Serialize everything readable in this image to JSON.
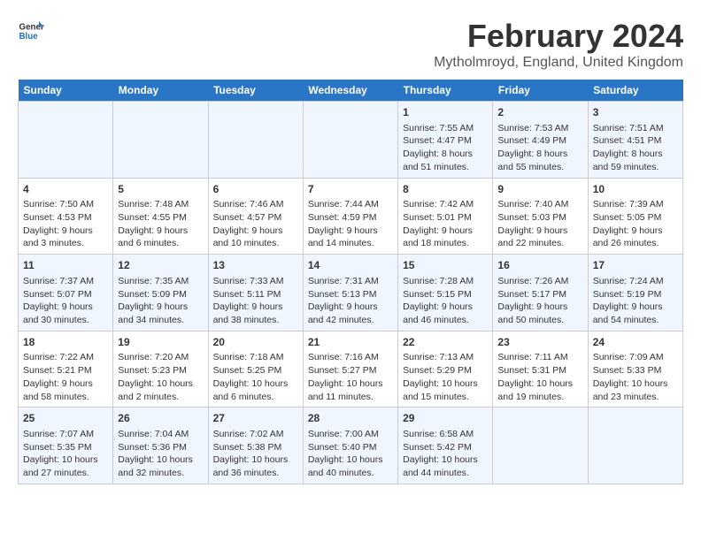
{
  "logo": {
    "line1": "General",
    "line2": "Blue"
  },
  "title": "February 2024",
  "subtitle": "Mytholmroyd, England, United Kingdom",
  "weekdays": [
    "Sunday",
    "Monday",
    "Tuesday",
    "Wednesday",
    "Thursday",
    "Friday",
    "Saturday"
  ],
  "weeks": [
    [
      {
        "day": "",
        "info": ""
      },
      {
        "day": "",
        "info": ""
      },
      {
        "day": "",
        "info": ""
      },
      {
        "day": "",
        "info": ""
      },
      {
        "day": "1",
        "info": "Sunrise: 7:55 AM\nSunset: 4:47 PM\nDaylight: 8 hours\nand 51 minutes."
      },
      {
        "day": "2",
        "info": "Sunrise: 7:53 AM\nSunset: 4:49 PM\nDaylight: 8 hours\nand 55 minutes."
      },
      {
        "day": "3",
        "info": "Sunrise: 7:51 AM\nSunset: 4:51 PM\nDaylight: 8 hours\nand 59 minutes."
      }
    ],
    [
      {
        "day": "4",
        "info": "Sunrise: 7:50 AM\nSunset: 4:53 PM\nDaylight: 9 hours\nand 3 minutes."
      },
      {
        "day": "5",
        "info": "Sunrise: 7:48 AM\nSunset: 4:55 PM\nDaylight: 9 hours\nand 6 minutes."
      },
      {
        "day": "6",
        "info": "Sunrise: 7:46 AM\nSunset: 4:57 PM\nDaylight: 9 hours\nand 10 minutes."
      },
      {
        "day": "7",
        "info": "Sunrise: 7:44 AM\nSunset: 4:59 PM\nDaylight: 9 hours\nand 14 minutes."
      },
      {
        "day": "8",
        "info": "Sunrise: 7:42 AM\nSunset: 5:01 PM\nDaylight: 9 hours\nand 18 minutes."
      },
      {
        "day": "9",
        "info": "Sunrise: 7:40 AM\nSunset: 5:03 PM\nDaylight: 9 hours\nand 22 minutes."
      },
      {
        "day": "10",
        "info": "Sunrise: 7:39 AM\nSunset: 5:05 PM\nDaylight: 9 hours\nand 26 minutes."
      }
    ],
    [
      {
        "day": "11",
        "info": "Sunrise: 7:37 AM\nSunset: 5:07 PM\nDaylight: 9 hours\nand 30 minutes."
      },
      {
        "day": "12",
        "info": "Sunrise: 7:35 AM\nSunset: 5:09 PM\nDaylight: 9 hours\nand 34 minutes."
      },
      {
        "day": "13",
        "info": "Sunrise: 7:33 AM\nSunset: 5:11 PM\nDaylight: 9 hours\nand 38 minutes."
      },
      {
        "day": "14",
        "info": "Sunrise: 7:31 AM\nSunset: 5:13 PM\nDaylight: 9 hours\nand 42 minutes."
      },
      {
        "day": "15",
        "info": "Sunrise: 7:28 AM\nSunset: 5:15 PM\nDaylight: 9 hours\nand 46 minutes."
      },
      {
        "day": "16",
        "info": "Sunrise: 7:26 AM\nSunset: 5:17 PM\nDaylight: 9 hours\nand 50 minutes."
      },
      {
        "day": "17",
        "info": "Sunrise: 7:24 AM\nSunset: 5:19 PM\nDaylight: 9 hours\nand 54 minutes."
      }
    ],
    [
      {
        "day": "18",
        "info": "Sunrise: 7:22 AM\nSunset: 5:21 PM\nDaylight: 9 hours\nand 58 minutes."
      },
      {
        "day": "19",
        "info": "Sunrise: 7:20 AM\nSunset: 5:23 PM\nDaylight: 10 hours\nand 2 minutes."
      },
      {
        "day": "20",
        "info": "Sunrise: 7:18 AM\nSunset: 5:25 PM\nDaylight: 10 hours\nand 6 minutes."
      },
      {
        "day": "21",
        "info": "Sunrise: 7:16 AM\nSunset: 5:27 PM\nDaylight: 10 hours\nand 11 minutes."
      },
      {
        "day": "22",
        "info": "Sunrise: 7:13 AM\nSunset: 5:29 PM\nDaylight: 10 hours\nand 15 minutes."
      },
      {
        "day": "23",
        "info": "Sunrise: 7:11 AM\nSunset: 5:31 PM\nDaylight: 10 hours\nand 19 minutes."
      },
      {
        "day": "24",
        "info": "Sunrise: 7:09 AM\nSunset: 5:33 PM\nDaylight: 10 hours\nand 23 minutes."
      }
    ],
    [
      {
        "day": "25",
        "info": "Sunrise: 7:07 AM\nSunset: 5:35 PM\nDaylight: 10 hours\nand 27 minutes."
      },
      {
        "day": "26",
        "info": "Sunrise: 7:04 AM\nSunset: 5:36 PM\nDaylight: 10 hours\nand 32 minutes."
      },
      {
        "day": "27",
        "info": "Sunrise: 7:02 AM\nSunset: 5:38 PM\nDaylight: 10 hours\nand 36 minutes."
      },
      {
        "day": "28",
        "info": "Sunrise: 7:00 AM\nSunset: 5:40 PM\nDaylight: 10 hours\nand 40 minutes."
      },
      {
        "day": "29",
        "info": "Sunrise: 6:58 AM\nSunset: 5:42 PM\nDaylight: 10 hours\nand 44 minutes."
      },
      {
        "day": "",
        "info": ""
      },
      {
        "day": "",
        "info": ""
      }
    ]
  ]
}
